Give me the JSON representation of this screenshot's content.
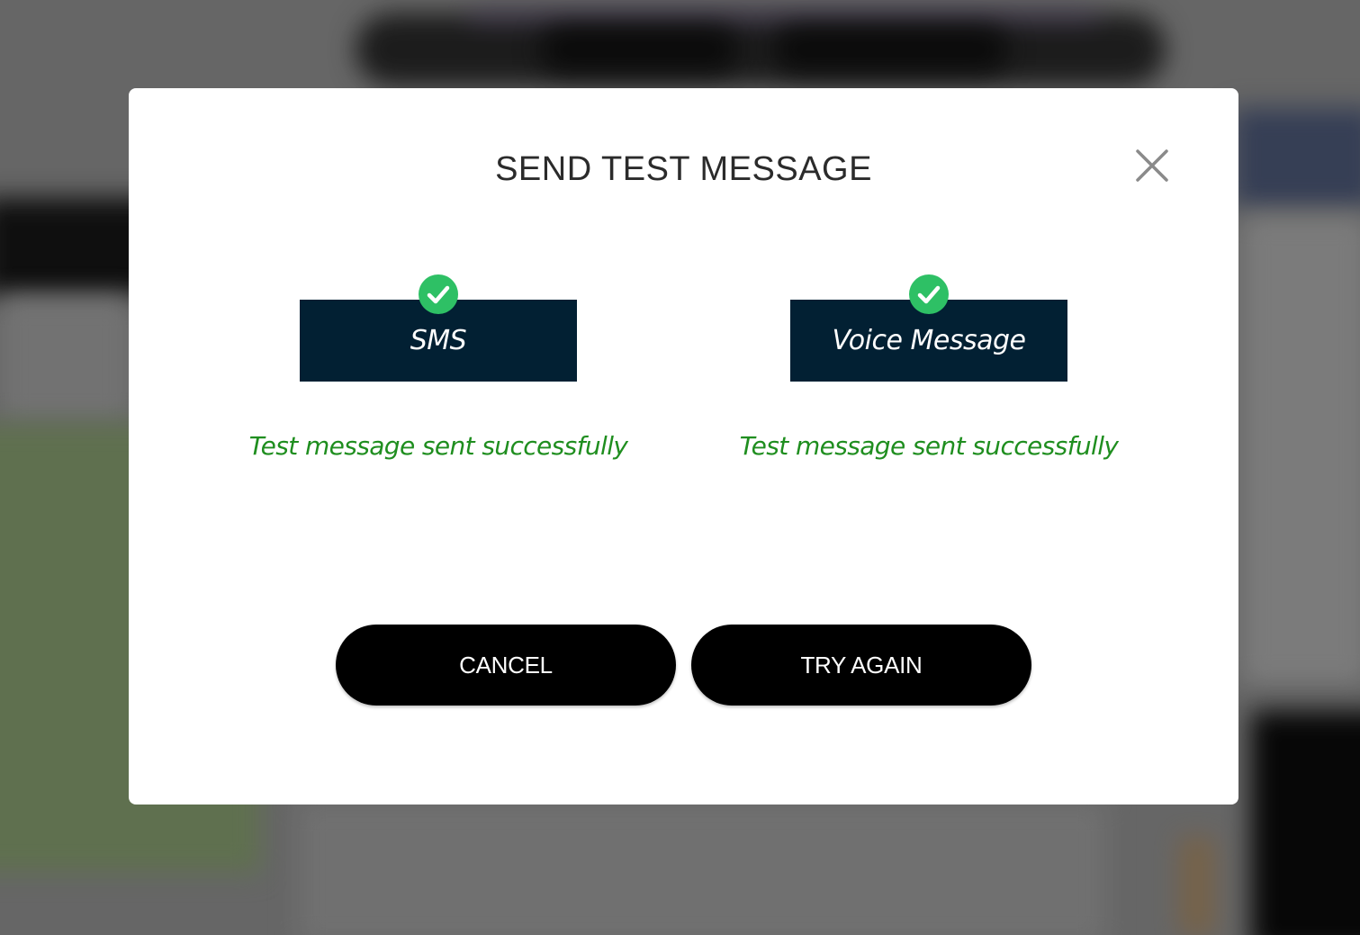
{
  "modal": {
    "title": "SEND TEST MESSAGE",
    "close_icon": "close-x-icon"
  },
  "channels": [
    {
      "label": "SMS",
      "status": "Test message sent successfully",
      "status_icon": "check-circle-icon",
      "status_color": "#1f8e1f"
    },
    {
      "label": "Voice Message",
      "status": "Test message sent successfully",
      "status_icon": "check-circle-icon",
      "status_color": "#1f8e1f"
    }
  ],
  "actions": {
    "cancel_label": "CANCEL",
    "retry_label": "TRY AGAIN"
  },
  "colors": {
    "channel_box": "#022033",
    "badge": "#2ec065",
    "button": "#000000",
    "success_text": "#1f8e1f"
  }
}
